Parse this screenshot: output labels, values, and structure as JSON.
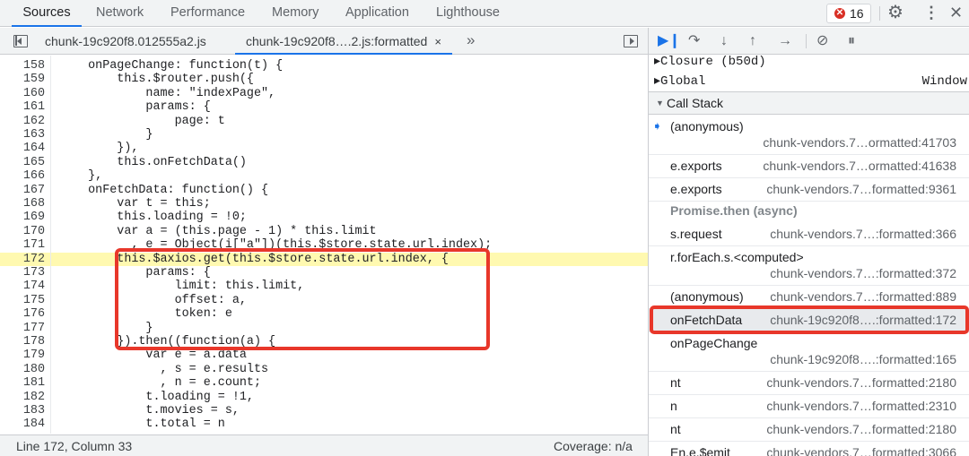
{
  "panel_tabs": [
    "Sources",
    "Network",
    "Performance",
    "Memory",
    "Application",
    "Lighthouse"
  ],
  "error_count": "16",
  "editor": {
    "tabs": [
      {
        "label": "chunk-19c920f8.012555a2.js"
      },
      {
        "label": "chunk-19c920f8….2.js:formatted",
        "close": "×"
      }
    ],
    "more": "»",
    "highlight_line": "172",
    "lines": [
      {
        "no": "158",
        "code": "    onPageChange: function(t) {"
      },
      {
        "no": "159",
        "code": "        this.$router.push({"
      },
      {
        "no": "160",
        "code": "            name: \"indexPage\","
      },
      {
        "no": "161",
        "code": "            params: {"
      },
      {
        "no": "162",
        "code": "                page: t"
      },
      {
        "no": "163",
        "code": "            }"
      },
      {
        "no": "164",
        "code": "        }),"
      },
      {
        "no": "165",
        "code": "        this.onFetchData()"
      },
      {
        "no": "166",
        "code": "    },"
      },
      {
        "no": "167",
        "code": "    onFetchData: function() {"
      },
      {
        "no": "168",
        "code": "        var t = this;"
      },
      {
        "no": "169",
        "code": "        this.loading = !0;"
      },
      {
        "no": "170",
        "code": "        var a = (this.page - 1) * this.limit"
      },
      {
        "no": "171",
        "code": "          , e = Object(i[\"a\"])(this.$store.state.url.index);"
      },
      {
        "no": "172",
        "code": "        this.$axios.get(this.$store.state.url.index, {"
      },
      {
        "no": "173",
        "code": "            params: {"
      },
      {
        "no": "174",
        "code": "                limit: this.limit,"
      },
      {
        "no": "175",
        "code": "                offset: a,"
      },
      {
        "no": "176",
        "code": "                token: e"
      },
      {
        "no": "177",
        "code": "            }"
      },
      {
        "no": "178",
        "code": "        }).then((function(a) {"
      },
      {
        "no": "179",
        "code": "            var e = a.data"
      },
      {
        "no": "180",
        "code": "              , s = e.results"
      },
      {
        "no": "181",
        "code": "              , n = e.count;"
      },
      {
        "no": "182",
        "code": "            t.loading = !1,"
      },
      {
        "no": "183",
        "code": "            t.movies = s,"
      },
      {
        "no": "184",
        "code": "            t.total = n"
      }
    ]
  },
  "status": {
    "position": "Line 172, Column 33",
    "coverage": "Coverage: n/a"
  },
  "scope": [
    {
      "name": "Closure (b50d)",
      "value": ""
    },
    {
      "name": "Global",
      "value": "Window"
    }
  ],
  "call_stack": {
    "title": "Call Stack",
    "frames": [
      {
        "fn": "(anonymous)",
        "loc": "chunk-vendors.7…ormatted:41703",
        "current": true,
        "two_line": true
      },
      {
        "fn": "e.exports",
        "loc": "chunk-vendors.7…ormatted:41638"
      },
      {
        "fn": "e.exports",
        "loc": "chunk-vendors.7…formatted:9361"
      },
      {
        "fn": "Promise.then (async)",
        "loc": "",
        "async": true
      },
      {
        "fn": "s.request",
        "loc": "chunk-vendors.7…:formatted:366"
      },
      {
        "fn": "r.forEach.s.<computed>",
        "loc": "chunk-vendors.7…:formatted:372",
        "two_line": true
      },
      {
        "fn": "(anonymous)",
        "loc": "chunk-vendors.7…:formatted:889"
      },
      {
        "fn": "onFetchData",
        "loc": "chunk-19c920f8….:formatted:172",
        "selected": true
      },
      {
        "fn": "onPageChange",
        "loc": "chunk-19c920f8….:formatted:165",
        "two_line": true
      },
      {
        "fn": "nt",
        "loc": "chunk-vendors.7…formatted:2180"
      },
      {
        "fn": "n",
        "loc": "chunk-vendors.7…formatted:2310"
      },
      {
        "fn": "nt",
        "loc": "chunk-vendors.7…formatted:2180"
      },
      {
        "fn": "En.e.$emit",
        "loc": "chunk-vendors.7…formatted:3066"
      }
    ]
  },
  "colors": {
    "highlight_line_bg": "#fff9b0",
    "annotation_red": "#e8372a",
    "accent_blue": "#1a73e8"
  }
}
